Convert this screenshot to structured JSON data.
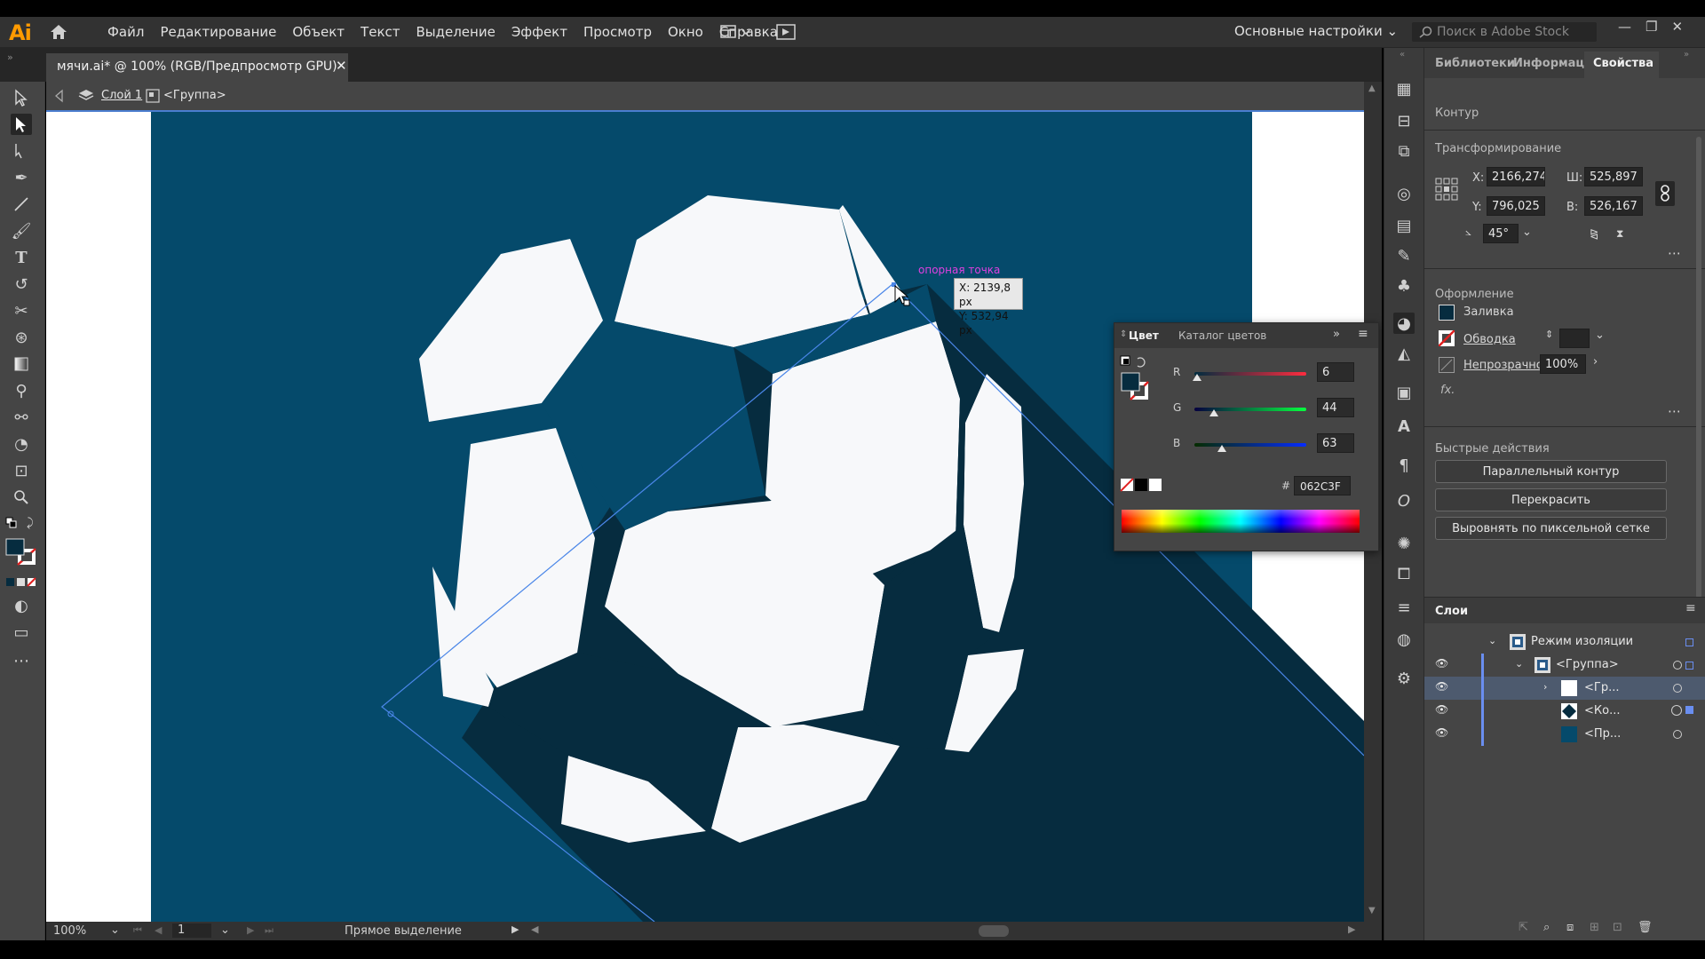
{
  "menu": {
    "items": [
      "Файл",
      "Редактирование",
      "Объект",
      "Текст",
      "Выделение",
      "Эффект",
      "Просмотр",
      "Окно",
      "Справка"
    ],
    "workspace": "Основные настройки",
    "stock_placeholder": "Поиск в Adobe Stock"
  },
  "app": {
    "logo": "Ai"
  },
  "document": {
    "tab_title": "мячи.ai* @ 100% (RGB/Предпросмотр GPU)",
    "close": "✕",
    "breadcrumb_layer": "Слой 1",
    "breadcrumb_group": "<Группа>"
  },
  "canvas": {
    "anchor_label": "опорная точка",
    "tooltip_x": "X: 2139,8 px",
    "tooltip_y": "Y: 532,94 px",
    "colors": {
      "background": "#054a6b",
      "shadow": "#062c3f",
      "ball": "#f7f8fa",
      "artboard": "#ffffff"
    }
  },
  "status": {
    "zoom": "100%",
    "artboard": "1",
    "tool": "Прямое выделение"
  },
  "color_panel": {
    "tabs": [
      "Цвет",
      "Каталог цветов"
    ],
    "r_label": "R",
    "g_label": "G",
    "b_label": "B",
    "r": "6",
    "g": "44",
    "b": "63",
    "r_level": 0.024,
    "g_level": 0.173,
    "b_level": 0.247,
    "hash": "#",
    "hex": "062C3F"
  },
  "properties": {
    "tabs": [
      "Библиотеки",
      "Информация",
      "Свойства"
    ],
    "object_type": "Контур",
    "transform": {
      "title": "Трансформирование",
      "x_label": "X:",
      "x": "2166,274 р",
      "y_label": "Y:",
      "y": "796,025 рх",
      "w_label": "Ш:",
      "w": "525,897 рх",
      "h_label": "В:",
      "h": "526,167 рх",
      "angle": "45°"
    },
    "appearance": {
      "title": "Оформление",
      "fill": "Заливка",
      "stroke": "Обводка",
      "opacity_label": "Непрозрачность",
      "opacity": "100%",
      "fx": "fx."
    },
    "quick_actions": {
      "title": "Быстрые действия",
      "offset_path": "Параллельный контур",
      "recolor": "Перекрасить",
      "pixel_align": "Выровнять по пиксельной сетке"
    }
  },
  "layers": {
    "title": "Слои",
    "rows": [
      {
        "name": "Режим изоляции"
      },
      {
        "name": "<Группа>"
      },
      {
        "name": "<Гр..."
      },
      {
        "name": "<Ко..."
      },
      {
        "name": "<Пр..."
      }
    ]
  }
}
